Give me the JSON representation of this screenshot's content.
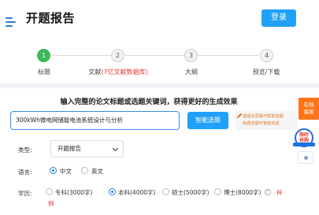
{
  "header": {
    "title": "开题报告",
    "login_label": "登录"
  },
  "steps": [
    {
      "num": "1",
      "label": "标题",
      "active": true
    },
    {
      "num": "2",
      "label": "文献",
      "extra": "(7亿文献数据库)",
      "active": false
    },
    {
      "num": "3",
      "label": "大纲",
      "active": false
    },
    {
      "num": "4",
      "label": "预览/下载",
      "active": false
    }
  ],
  "form": {
    "heading": "输入完整的论文标题或选题关键词，获得更好的生成效果",
    "topic_value": "300kWh微电网储能电池系统设计与分析",
    "smart_button": "智能选题",
    "help_line1": "选题没思路可帮助选题",
    "help_line2": "免费选题可智能完成",
    "type_label": "类型:",
    "type_value": "开题报告",
    "lang_label": "语言:",
    "lang_options": [
      {
        "label": "中文",
        "checked": true
      },
      {
        "label": "英文",
        "checked": false
      }
    ],
    "degree_label": "学历:",
    "degree_options": [
      {
        "label": "专科(3000字)",
        "checked": false
      },
      {
        "label": "本科(4000字)",
        "checked": true
      },
      {
        "label": "硕士(5000字)",
        "checked": false
      },
      {
        "label": "博士(8000字)",
        "checked": false
      }
    ],
    "sample_label_part1": "样",
    "sample_label_part2": "例"
  },
  "side": {
    "online_line1": "在线",
    "online_line2": "客服",
    "limited_line1": "限时",
    "limited_line2": "抢购"
  },
  "icons": {
    "menu": "menu-icon",
    "chevron": "chevron-down-icon",
    "pencil": "pencil-icon",
    "question": "question-icon"
  },
  "colors": {
    "accent": "#20a0f6",
    "step_active": "#3db85c",
    "highlight_red": "#e53935",
    "service_orange": "#ff7418"
  }
}
